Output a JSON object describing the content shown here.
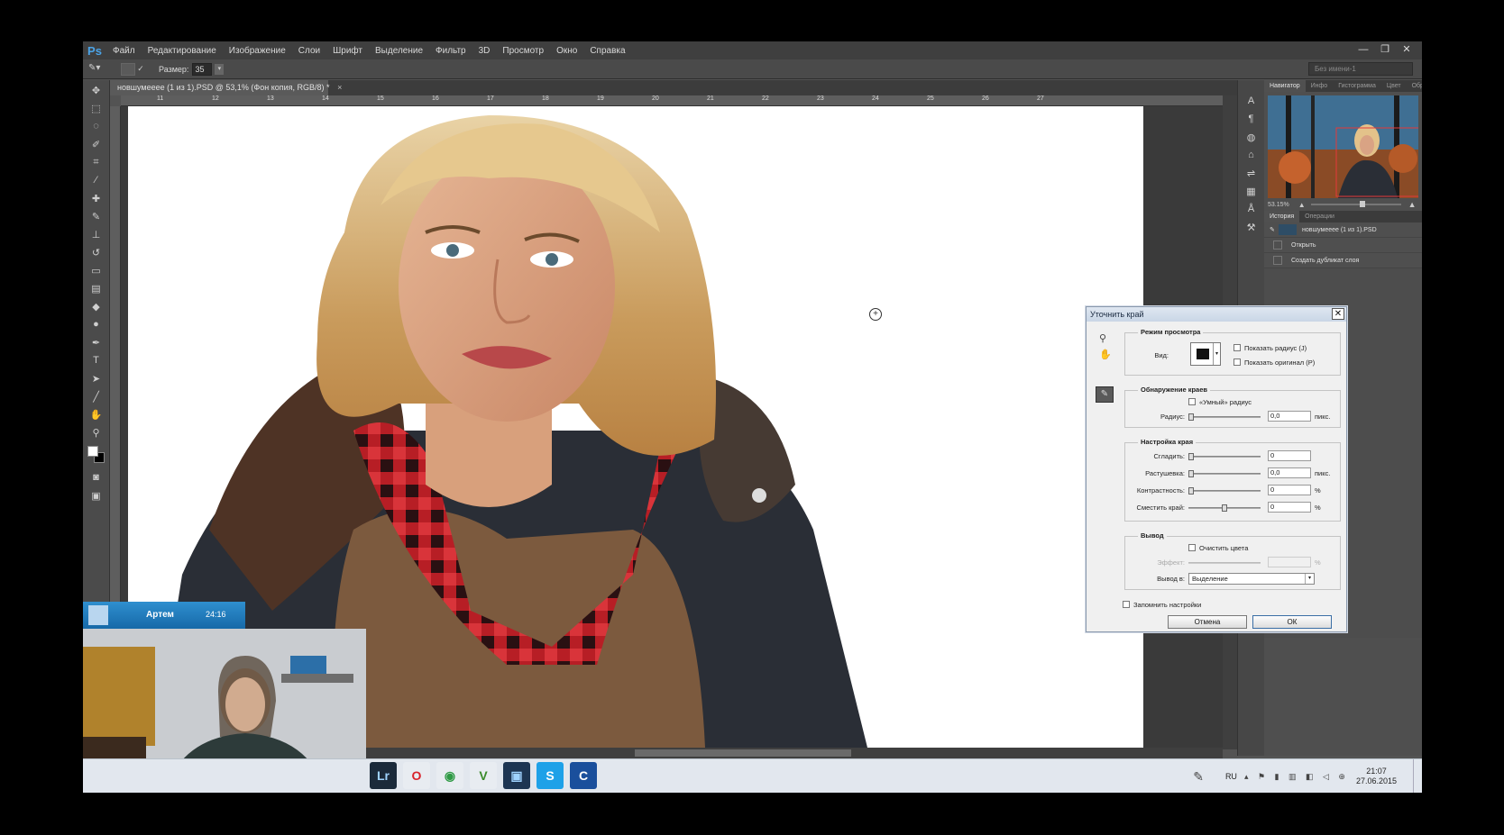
{
  "app": {
    "logo": "Ps"
  },
  "menu": [
    "Файл",
    "Редактирование",
    "Изображение",
    "Слои",
    "Шрифт",
    "Выделение",
    "Фильтр",
    "3D",
    "Просмотр",
    "Окно",
    "Справка"
  ],
  "options_bar": {
    "size_label": "Размер:",
    "size_value": "35",
    "workspace": "Без имени-1"
  },
  "document": {
    "tab_title": "новшумееее (1 из 1).PSD @ 53,1% (Фон копия, RGB/8) *",
    "ruler_ticks": [
      "11",
      "12",
      "13",
      "14",
      "15",
      "16",
      "17",
      "18",
      "19",
      "20",
      "21",
      "22",
      "23",
      "24",
      "25",
      "26",
      "27"
    ]
  },
  "panels": {
    "nav_tabs": [
      "Навигатор",
      "Инфо",
      "Гистограмма",
      "Цвет",
      "Образцы"
    ],
    "nav_zoom": "53.15%",
    "history_tabs": [
      "История",
      "Операции"
    ],
    "history_snapshot": "новшумееее (1 из 1).PSD",
    "history_items": [
      "Открыть",
      "Создать дубликат слоя"
    ]
  },
  "dialog": {
    "title": "Уточнить край",
    "view_mode": {
      "title": "Режим просмотра",
      "view_label": "Вид:",
      "show_radius": "Показать радиус (J)",
      "show_original": "Показать оригинал (P)"
    },
    "edge_detection": {
      "title": "Обнаружение краев",
      "smart_radius": "«Умный» радиус",
      "radius_label": "Радиус:",
      "radius_value": "0,0",
      "radius_unit": "пикс."
    },
    "adjust_edge": {
      "title": "Настройка края",
      "smooth_label": "Сгладить:",
      "smooth_value": "0",
      "feather_label": "Растушевка:",
      "feather_value": "0,0",
      "feather_unit": "пикс.",
      "contrast_label": "Контрастность:",
      "contrast_value": "0",
      "contrast_unit": "%",
      "shift_label": "Сместить край:",
      "shift_value": "0",
      "shift_unit": "%"
    },
    "output": {
      "title": "Вывод",
      "decontaminate": "Очистить цвета",
      "amount_label": "Эффект:",
      "amount_unit": "%",
      "output_to_label": "Вывод в:",
      "output_to_value": "Выделение"
    },
    "remember": "Запомнить настройки",
    "cancel": "Отмена",
    "ok": "ОК"
  },
  "webcam": {
    "name": "Артем",
    "duration": "24:16"
  },
  "taskbar": {
    "apps": [
      {
        "glyph": "Lr",
        "icon": "lightroom-icon",
        "bg": "#1b2a3a",
        "fg": "#9fd3ff"
      },
      {
        "glyph": "O",
        "icon": "opera-icon",
        "bg": "#e8ecf1",
        "fg": "#d8232a"
      },
      {
        "glyph": "◉",
        "icon": "chrome-icon",
        "bg": "#e8ecf1",
        "fg": "#2f9a45"
      },
      {
        "glyph": "V",
        "icon": "v-app-icon",
        "bg": "#e8ecf1",
        "fg": "#3a8a2a"
      },
      {
        "glyph": "▣",
        "icon": "photoshop-taskbar-icon",
        "bg": "#1d3552",
        "fg": "#9fd3ff"
      },
      {
        "glyph": "S",
        "icon": "skype-icon",
        "bg": "#1ea1e8",
        "fg": "#ffffff"
      },
      {
        "glyph": "C",
        "icon": "ccleaner-icon",
        "bg": "#1a4f9c",
        "fg": "#ffffff"
      }
    ],
    "lang": "RU",
    "time": "21:07",
    "date": "27.06.2015"
  }
}
